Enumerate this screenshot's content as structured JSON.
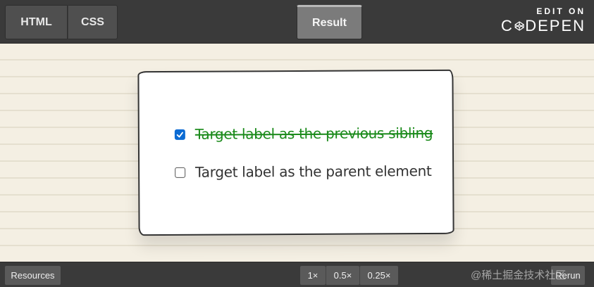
{
  "topbar": {
    "tabs": [
      {
        "label": "HTML"
      },
      {
        "label": "CSS"
      }
    ],
    "result_tab": "Result",
    "codepen": {
      "edit_on": "EDIT ON",
      "brand_prefix": "C",
      "brand_suffix": "DEPEN"
    }
  },
  "card": {
    "items": [
      {
        "label": "Target label as the previous sibling",
        "checked": true
      },
      {
        "label": "Target label as the parent element",
        "checked": false
      }
    ]
  },
  "bottombar": {
    "resources": "Resources",
    "zoom": [
      "1×",
      "0.5×",
      "0.25×"
    ],
    "rerun": "Rerun"
  },
  "watermark": "@稀土掘金技术社区",
  "colors": {
    "bar_bg": "#3a3a3a",
    "paper_bg": "#f4efe3",
    "checkbox_checked": "#0b6bd3",
    "done_text": "#1a8a1a"
  }
}
